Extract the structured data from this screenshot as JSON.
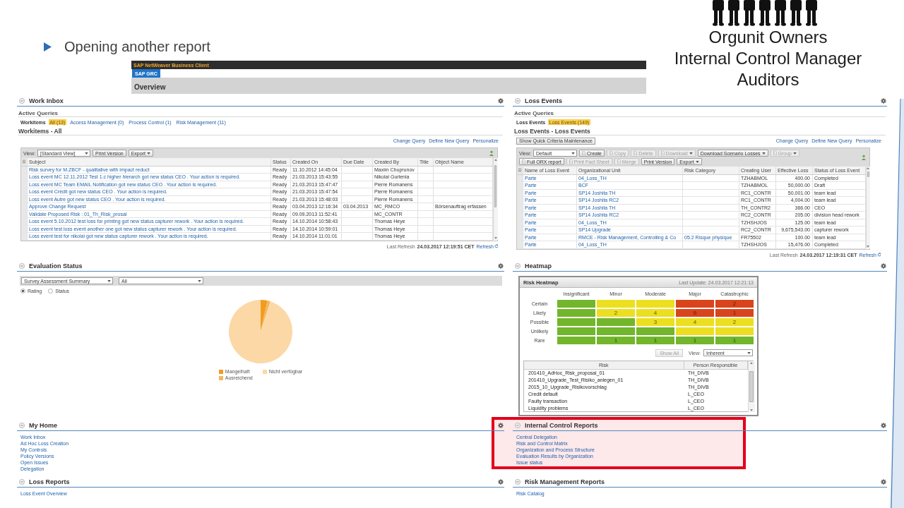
{
  "slide": {
    "title": "Opening another report",
    "audience": [
      "Orgunit Owners",
      "Internal Control Manager",
      "Auditors"
    ]
  },
  "app": {
    "title": "SAP NetWeaver Business Client",
    "tabs": [
      {
        "label": "SAP GRC",
        "selected": true
      }
    ],
    "page_title": "Overview"
  },
  "work_inbox": {
    "title": "Work Inbox",
    "active_queries": {
      "title": "Active Queries",
      "label": "Workitems",
      "queries": [
        {
          "label": "All (13)",
          "selected": true
        },
        {
          "label": "Access Management (0)",
          "selected": false
        },
        {
          "label": "Process Control (1)",
          "selected": false
        },
        {
          "label": "Risk Management (11)",
          "selected": false
        }
      ]
    },
    "list_title": "Workitems - All",
    "links": [
      "Change Query",
      "Define New Query",
      "Personalize"
    ],
    "toolbar": [
      [
        {
          "kind": "view",
          "label": "View:",
          "value": "[Standard View]"
        },
        {
          "kind": "plain",
          "label": "Print Version",
          "disabled": false
        },
        {
          "kind": "menu",
          "label": "Export",
          "disabled": false
        }
      ]
    ],
    "table": {
      "columns": [
        "Subject",
        "Status",
        "Created On",
        "Due Date",
        "Created By",
        "Title",
        "Object Name"
      ],
      "rows": [
        {
          "subject": "Risk survey for M.ZBCF  - qualitative with impact reduct",
          "status": "Ready",
          "created_on": "11.10.2012 14:45:04",
          "created_by": "Maxim Chuprunov"
        },
        {
          "subject": "Loss event MC 12.11.2012 Test 1.c higher hierarch got new status CEO . Your action is required.",
          "status": "Ready",
          "created_on": "21.03.2013 15:43:55",
          "created_by": "Nikolai Gurlenia"
        },
        {
          "subject": "Loss event MC Team EMAIL Notification got new status CEO . Your action is required.",
          "status": "Ready",
          "created_on": "21.03.2013 15:47:47",
          "created_by": "Pierre Romanens"
        },
        {
          "subject": "Loss event Crédit got new status CEO . Your action is required.",
          "status": "Ready",
          "created_on": "21.03.2013 15:47:54",
          "created_by": "Pierre Romanens"
        },
        {
          "subject": "Loss event Autre got new status CEO . Your action is required.",
          "status": "Ready",
          "created_on": "21.03.2013 15:48:03",
          "created_by": "Pierre Romanens"
        },
        {
          "subject": "Approve Change Request",
          "status": "Ready",
          "created_on": "03.04.2013 12:16:34",
          "due_date": "03.04.2013",
          "created_by": "MC_RMCO",
          "object_name": "Börsenauftrag erfassen"
        },
        {
          "subject": "Validate Proposed Risk : 01_Th_Risk_prosal",
          "status": "Ready",
          "created_on": "09.09.2013 11:52:41",
          "created_by": "MC_CONTR"
        },
        {
          "subject": "Loss event 5.10.2012 test loss for printing got new status capturer rework . Your action is required.",
          "status": "Ready",
          "created_on": "14.10.2014 10:58:43",
          "created_by": "Thomas Heye"
        },
        {
          "subject": "Loss event test loss event another one got new status capturer rework . Your action is required.",
          "status": "Ready",
          "created_on": "14.10.2014 10:59:01",
          "created_by": "Thomas Heye"
        },
        {
          "subject": "Loss event test for nikolai got new status capturer rework . Your action is required.",
          "status": "Ready",
          "created_on": "14.10.2014 11:01:01",
          "created_by": "Thomas Heye"
        }
      ]
    },
    "last_refresh": {
      "label": "Last Refresh",
      "time": "24.03.2017 12:19:51 CET",
      "link": "Refresh"
    }
  },
  "loss_events": {
    "title": "Loss Events",
    "active_queries": {
      "title": "Active Queries",
      "label": "Loss Events",
      "queries": [
        {
          "label": "Loss Events (149)",
          "selected": true
        }
      ]
    },
    "list_title": "Loss Events - Loss Events",
    "quick_criteria_button": "Show Quick Criteria Maintenance",
    "links": [
      "Change Query",
      "Define New Query",
      "Personalize"
    ],
    "toolbar": [
      [
        {
          "kind": "view",
          "label": "View:",
          "value": "Default"
        },
        {
          "kind": "icon",
          "label": "Create",
          "disabled": false
        },
        {
          "kind": "icon",
          "label": "Copy",
          "disabled": true
        },
        {
          "kind": "icon",
          "label": "Delete",
          "disabled": true
        },
        {
          "kind": "icon_menu",
          "label": "Download",
          "disabled": true
        },
        {
          "kind": "menu",
          "label": "Download Scenario Losses",
          "disabled": false
        },
        {
          "kind": "icon_menu",
          "label": "Group",
          "disabled": true
        }
      ],
      [
        {
          "kind": "icon",
          "label": "Full ORX report",
          "disabled": false
        },
        {
          "kind": "icon",
          "label": "Print Fact Sheet",
          "disabled": true
        },
        {
          "kind": "icon",
          "label": "Merge",
          "disabled": true
        },
        {
          "kind": "plain",
          "label": "Print Version",
          "disabled": false
        },
        {
          "kind": "menu",
          "label": "Export",
          "disabled": false
        }
      ]
    ],
    "table": {
      "columns": [
        "Name of Loss Event",
        "Organizational Unit",
        "Risk Category",
        "Creating User",
        "Effective Loss",
        "Status of Loss Event"
      ],
      "rows": [
        {
          "name": "Parte",
          "org_unit": "04_Loss_TH",
          "creating_user": "TZHABMOL",
          "effective_loss": "400.00",
          "status": "Completed"
        },
        {
          "name": "Parte",
          "org_unit": "BCF",
          "creating_user": "TZHABMOL",
          "effective_loss": "50,000.00",
          "status": "Draft"
        },
        {
          "name": "Parte",
          "org_unit": "SP14 Joshita TH",
          "creating_user": "RC1_CONTR",
          "effective_loss": "50,001.00",
          "status": "team lead"
        },
        {
          "name": "Parte",
          "org_unit": "SP14 Joshita RC2",
          "creating_user": "RC1_CONTR",
          "effective_loss": "4,004.00",
          "status": "team lead"
        },
        {
          "name": "Parte",
          "org_unit": "SP14 Joshita TH",
          "creating_user": "TH_CONTR2",
          "effective_loss": "366.00",
          "status": "CEO"
        },
        {
          "name": "Parte",
          "org_unit": "SP14 Joshita RC2",
          "creating_user": "RC2_CONTR",
          "effective_loss": "205.00",
          "status": "division head rework"
        },
        {
          "name": "Parte",
          "org_unit": "04_Loss_TH",
          "creating_user": "TZHSHJOS",
          "effective_loss": "125.00",
          "status": "team lead"
        },
        {
          "name": "Parte",
          "org_unit": "SP14 Upgrade",
          "creating_user": "RC2_CONTR",
          "effective_loss": "9,675,543.00",
          "status": "capturer rework"
        },
        {
          "name": "Parte",
          "org_unit": "RMCE - Risk Management, Controlling & Co",
          "risk_category": "05.2 Risque physique",
          "creating_user": "FR75502",
          "effective_loss": "100.00",
          "status": "team lead"
        },
        {
          "name": "Parte",
          "org_unit": "04_Loss_TH",
          "creating_user": "TZHSHJOS",
          "effective_loss": "15,476.00",
          "status": "Completed"
        }
      ]
    },
    "last_refresh": {
      "label": "Last Refresh",
      "time": "24.03.2017 12:19:31 CET",
      "link": "Refresh"
    }
  },
  "evaluation_status": {
    "title": "Evaluation Status",
    "selects": [
      "Survey Assessment Summary",
      "All"
    ],
    "options": [
      {
        "label": "Rating",
        "selected": true
      },
      {
        "label": "Status",
        "selected": false
      }
    ],
    "legend": [
      {
        "label": "Mangelhaft",
        "color": "#f29c1f"
      },
      {
        "label": "Nicht verfügbar",
        "color": "#fbd8a6"
      },
      {
        "label": "Ausreichend",
        "color": "#f7b55a"
      }
    ]
  },
  "heatmap": {
    "title": "Heatmap",
    "card_title": "Risk Heatmap",
    "last_update": "Last Update: 24.03.2017 12:21:13",
    "impacts": [
      "Insignificant",
      "Minor",
      "Moderate",
      "Major",
      "Catastrophic"
    ],
    "rows": [
      {
        "label": "Certain",
        "cells": [
          {
            "color": "#72b62c"
          },
          {
            "color": "#ecdf1f"
          },
          {
            "color": "#ecdf1f"
          },
          {
            "color": "#d9441c"
          },
          {
            "color": "#d9441c",
            "value": "2"
          }
        ]
      },
      {
        "label": "Likely",
        "cells": [
          {
            "color": "#72b62c"
          },
          {
            "color": "#ecdf1f",
            "value": "2"
          },
          {
            "color": "#ecdf1f",
            "value": "4"
          },
          {
            "color": "#d9441c",
            "value": "6"
          },
          {
            "color": "#d9441c",
            "value": "1"
          }
        ]
      },
      {
        "label": "Possible",
        "cells": [
          {
            "color": "#72b62c"
          },
          {
            "color": "#72b62c"
          },
          {
            "color": "#ecdf1f",
            "value": "3"
          },
          {
            "color": "#ecdf1f",
            "value": "4"
          },
          {
            "color": "#ecdf1f",
            "value": "2"
          }
        ]
      },
      {
        "label": "Unlikely",
        "cells": [
          {
            "color": "#72b62c"
          },
          {
            "color": "#72b62c"
          },
          {
            "color": "#72b62c"
          },
          {
            "color": "#ecdf1f"
          },
          {
            "color": "#ecdf1f"
          }
        ]
      },
      {
        "label": "Rare",
        "cells": [
          {
            "color": "#72b62c"
          },
          {
            "color": "#72b62c",
            "value": "1"
          },
          {
            "color": "#72b62c",
            "value": "1"
          },
          {
            "color": "#72b62c",
            "value": "1"
          },
          {
            "color": "#72b62c",
            "value": "1"
          }
        ]
      }
    ],
    "show_all": {
      "label": "Show All",
      "disabled": true
    },
    "view": {
      "label": "View:",
      "value": "Inherent"
    },
    "table": {
      "columns": [
        "Risk",
        "Person Responsible"
      ],
      "rows": [
        {
          "risk": "201410_AdHoc_Risk_proposal_01",
          "person": "TH_DIVB"
        },
        {
          "risk": "201410_Upgrade_Test_Risiko_anlegen_01",
          "person": "TH_DIVB"
        },
        {
          "risk": "2015_10_Upgrade_Risikovorschlag",
          "person": "TH_DIVB"
        },
        {
          "risk": "Credit default",
          "person": "L_CEO"
        },
        {
          "risk": "Faulty transaction",
          "person": "L_CEO"
        },
        {
          "risk": "Liquidity problems",
          "person": "L_CEO"
        }
      ]
    }
  },
  "my_home": {
    "title": "My Home",
    "links": [
      "Work Inbox",
      "Ad Hoc Loss Creation",
      "My Controls",
      "Policy Versions",
      "Open Issues",
      "Delegation"
    ]
  },
  "internal_control_reports": {
    "title": "Internal Control Reports",
    "highlighted": true,
    "links": [
      "Central Delegation",
      "Risk and Control Matrix",
      "Organization and Process Structure",
      "Evaluation Results by Organization",
      "Issue status"
    ]
  },
  "loss_reports": {
    "title": "Loss Reports",
    "links": [
      "Loss Event Overview"
    ]
  },
  "risk_management_reports": {
    "title": "Risk Management Reports",
    "links": [
      "Risk Catalog"
    ]
  }
}
